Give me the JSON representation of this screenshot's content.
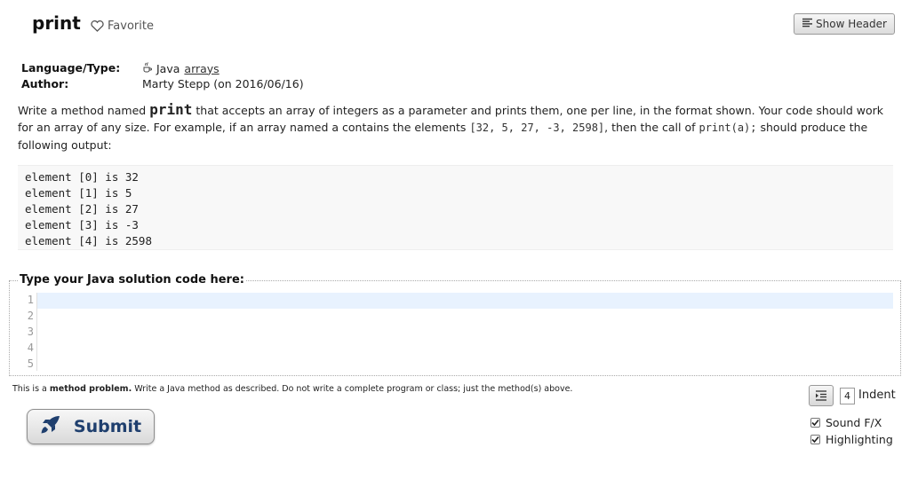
{
  "header": {
    "title": "print",
    "favorite_label": "Favorite",
    "show_header_label": "Show Header"
  },
  "info": {
    "language_label": "Language/Type:",
    "language_value": "Java",
    "type_link": "arrays",
    "author_label": "Author:",
    "author_value": "Marty Stepp (on 2016/06/16)"
  },
  "description": {
    "part1": "Write a method named ",
    "method_name": "print",
    "part2": " that accepts an array of integers as a parameter and prints them, one per line, in the format shown. Your code should work for an array of any size. For example, if an array named a contains the elements ",
    "example_array": "[32, 5, 27, -3, 2598]",
    "part3": ", then the call of ",
    "example_call": "print(a);",
    "part4": " should produce the following output:"
  },
  "output_lines": [
    "element [0] is 32",
    "element [1] is 5",
    "element [2] is 27",
    "element [3] is -3",
    "element [4] is 2598"
  ],
  "editor": {
    "legend": "Type your Java solution code here:",
    "line_numbers": [
      "1",
      "2",
      "3",
      "4",
      "5"
    ]
  },
  "note": {
    "prefix": "This is a ",
    "bold": "method problem.",
    "suffix": " Write a Java method as described. Do not write a complete program or class; just the method(s) above."
  },
  "controls": {
    "submit_label": "Submit",
    "indent_value": "4",
    "indent_label": "Indent",
    "sound_label": "Sound F/X",
    "highlight_label": "Highlighting",
    "sound_checked": true,
    "highlight_checked": true
  },
  "icons": {
    "favorite": "heart-icon",
    "show_header": "lines-icon",
    "java": "java-cup-icon",
    "submit": "rocket-icon",
    "indent": "indent-icon"
  },
  "colors": {
    "submit_text": "#1f3f6e",
    "active_line": "#e8f2fe"
  }
}
